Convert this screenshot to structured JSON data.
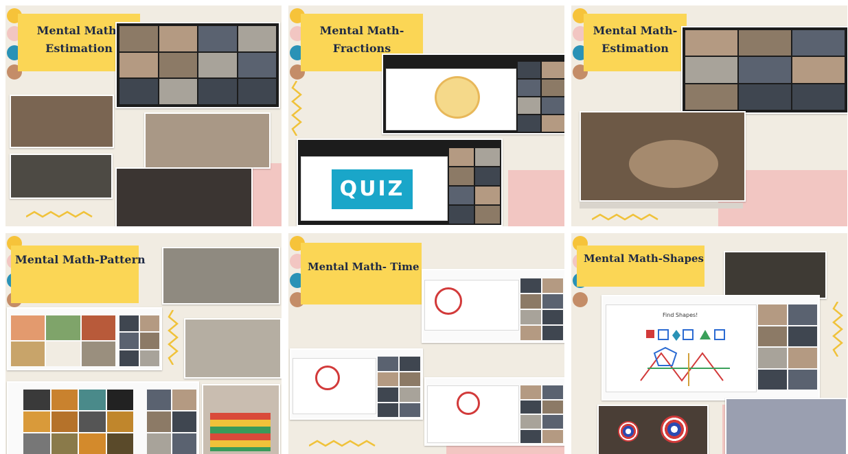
{
  "panels": [
    {
      "title": "Mental Math-\nEstimation"
    },
    {
      "title": "Mental Math-\nFractions"
    },
    {
      "title": "Mental Math-\nEstimation"
    },
    {
      "title": "Mental Math-Pattern"
    },
    {
      "title": "Mental Math- Time"
    },
    {
      "title": "Mental Math-Shapes"
    }
  ],
  "quiz_text": "QUIZ",
  "slide_heading": "Find Shapes!",
  "colors": {
    "background": "#f1ece2",
    "title_bar": "#fbd655",
    "accent_pink": "#f2c6c2",
    "dot_blue": "#2a92b6",
    "dot_brown": "#c48d68",
    "squiggle": "#f0c23a"
  }
}
